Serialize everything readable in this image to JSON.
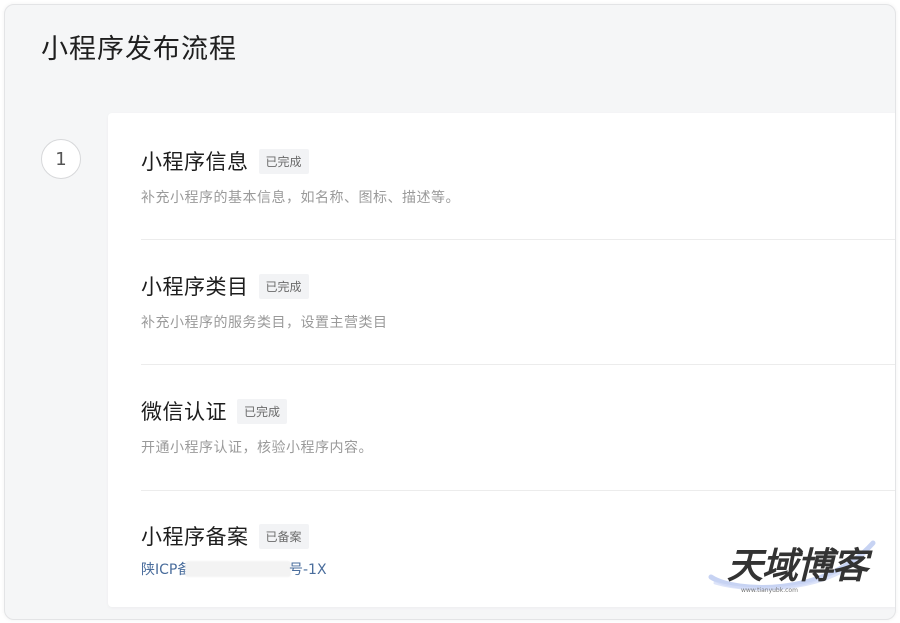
{
  "page_title": "小程序发布流程",
  "step_number": "1",
  "items": [
    {
      "title": "小程序信息",
      "status": "已完成",
      "description": "补充小程序的基本信息，如名称、图标、描述等。"
    },
    {
      "title": "小程序类目",
      "status": "已完成",
      "description": "补充小程序的服务类目，设置主营类目"
    },
    {
      "title": "微信认证",
      "status": "已完成",
      "description": "开通小程序认证，核验小程序内容。"
    },
    {
      "title": "小程序备案",
      "status": "已备案",
      "icp_prefix": "陕ICP备",
      "icp_suffix": "号-1X"
    }
  ],
  "watermark": {
    "text": "天域博客",
    "url": "www.tianyubk.com"
  },
  "colors": {
    "background": "#f5f6f7",
    "card": "#ffffff",
    "badge_bg": "#f2f3f5",
    "link": "#4a6d9c",
    "desc": "#9a9a9a"
  }
}
